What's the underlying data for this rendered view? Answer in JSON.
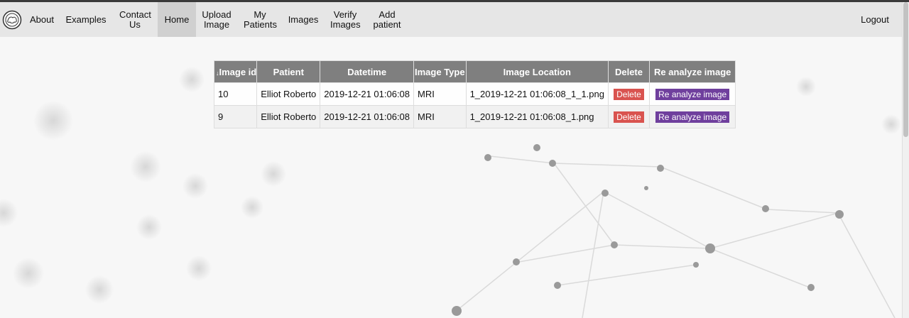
{
  "nav": {
    "logo_icon": "brain-logo-icon",
    "items": [
      {
        "label": "About"
      },
      {
        "label": "Examples"
      },
      {
        "label": "Contact Us"
      },
      {
        "label": "Home",
        "active": true
      },
      {
        "label": "Upload Image"
      },
      {
        "label": "My Patients"
      },
      {
        "label": "Images"
      },
      {
        "label": "Verify Images"
      },
      {
        "label": "Add patient"
      }
    ],
    "logout": "Logout"
  },
  "table": {
    "sort_icon": "sort-desc-icon",
    "headers": {
      "image_id": "Image id",
      "patient": "Patient",
      "datetime": "Datetime",
      "image_type": "Image Type",
      "image_location": "Image Location",
      "delete": "Delete",
      "reanalyze": "Re analyze image"
    },
    "rows": [
      {
        "image_id": "10",
        "patient": "Elliot Roberto",
        "datetime": "2019-12-21 01:06:08",
        "image_type": "MRI",
        "image_location": "1_2019-12-21 01:06:08_1_1.png",
        "delete": "Delete",
        "reanalyze": "Re analyze image"
      },
      {
        "image_id": "9",
        "patient": "Elliot Roberto",
        "datetime": "2019-12-21 01:06:08",
        "image_type": "MRI",
        "image_location": "1_2019-12-21 01:06:08_1.png",
        "delete": "Delete",
        "reanalyze": "Re analyze image"
      }
    ]
  },
  "colors": {
    "header_bg": "#7f7f7f",
    "delete_button": "#d9534f",
    "reanalyze_button": "#6f3f9d",
    "navbar_bg": "#e6e6e6"
  }
}
